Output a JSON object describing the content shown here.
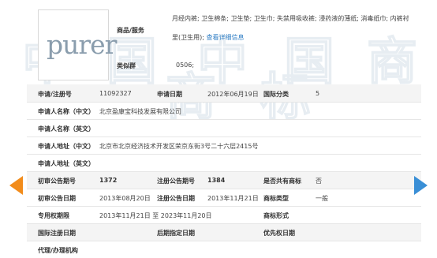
{
  "logo": {
    "text": "purer"
  },
  "goods_services": {
    "label": "商品/服务",
    "line1": "月经内裤; 卫生棉条; 卫生垫; 卫生巾; 失禁用吸收裤; 浸药液的薄纸; 消毒纸巾; 内裤衬",
    "line2": "里(卫生用);",
    "link": "查看详细信息"
  },
  "similar_group": {
    "label": "类似群",
    "value": "0506;"
  },
  "rows": {
    "reg_no_label": "申请/注册号",
    "reg_no": "11092327",
    "apply_date_label": "申请日期",
    "apply_date": "2012年06月19日",
    "intl_class_label": "国际分类",
    "intl_class": "5",
    "applicant_cn_label": "申请人名称（中文）",
    "applicant_cn": "北京盈康宝科技发展有限公司",
    "applicant_en_label": "申请人名称（英文）",
    "applicant_en": "",
    "address_cn_label": "申请人地址（中文）",
    "address_cn": "北京市北京经济技术开发区荣京东街3号二十六层2415号",
    "address_en_label": "申请人地址（英文）",
    "address_en": "",
    "prelim_no_label": "初审公告期号",
    "prelim_no": "1372",
    "reg_pub_no_label": "注册公告期号",
    "reg_pub_no": "1384",
    "shared_label": "是否共有商标",
    "shared": "否",
    "prelim_date_label": "初审公告日期",
    "prelim_date": "2013年08月20日",
    "reg_pub_date_label": "注册公告日期",
    "reg_pub_date": "2013年11月21日",
    "mark_type_label": "商标类型",
    "mark_type": "一般",
    "exclusive_label": "专用权期限",
    "exclusive": "2013年11月21日 至 2023年11月20日",
    "mark_form_label": "商标形式",
    "mark_form": "",
    "intl_reg_date_label": "国际注册日期",
    "intl_reg_date": "",
    "later_date_label": "后期指定日期",
    "later_date": "",
    "priority_label": "优先权日期",
    "priority": "",
    "agent_label": "代理/办理机构",
    "agent": ""
  },
  "watermark": {
    "char1": "中",
    "char2": "国",
    "char3": "商",
    "char4": "标"
  },
  "colors": {
    "prev_arrow": "#f28c1b",
    "next_arrow": "#3a8fd6",
    "link": "#2f7ec4"
  }
}
